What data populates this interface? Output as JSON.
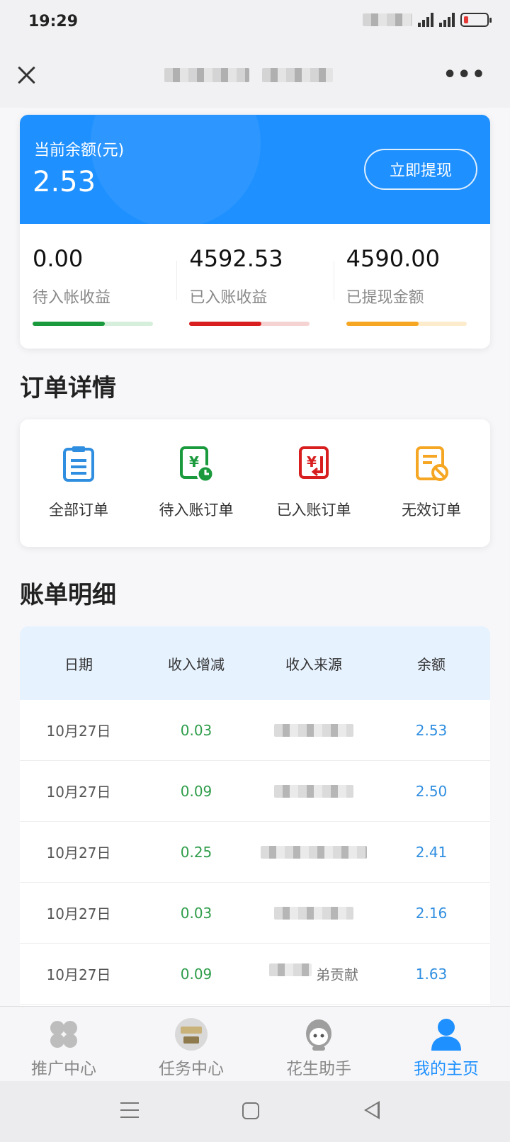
{
  "status": {
    "time": "19:29"
  },
  "header": {
    "title_obscured": true
  },
  "balance": {
    "label": "当前余额(元)",
    "value": "2.53",
    "withdraw_label": "立即提现"
  },
  "stats": [
    {
      "value": "0.00",
      "label": "待入帐收益",
      "color": "#1a9a3c",
      "track": "#d6efdc",
      "progress": 0.6
    },
    {
      "value": "4592.53",
      "label": "已入账收益",
      "color": "#d81e1e",
      "track": "#f6d3d3",
      "progress": 0.6
    },
    {
      "value": "4590.00",
      "label": "已提现金额",
      "color": "#f5a623",
      "track": "#fdeccb",
      "progress": 0.6
    }
  ],
  "orders": {
    "title": "订单详情",
    "items": [
      {
        "label": "全部订单",
        "icon": "clipboard-icon",
        "color": "#2f8ee0"
      },
      {
        "label": "待入账订单",
        "icon": "yen-clock-icon",
        "color": "#1a9a3c"
      },
      {
        "label": "已入账订单",
        "icon": "yen-return-icon",
        "color": "#d81e1e"
      },
      {
        "label": "无效订单",
        "icon": "invalid-doc-icon",
        "color": "#f5a623"
      }
    ]
  },
  "bills": {
    "title": "账单明细",
    "columns": [
      "日期",
      "收入增减",
      "收入来源",
      "余额"
    ],
    "rows": [
      {
        "date": "10月27日",
        "change": "0.03",
        "source": "",
        "balance": "2.53"
      },
      {
        "date": "10月27日",
        "change": "0.09",
        "source": "",
        "balance": "2.50"
      },
      {
        "date": "10月27日",
        "change": "0.25",
        "source": "",
        "balance": "2.41"
      },
      {
        "date": "10月27日",
        "change": "0.03",
        "source": "",
        "balance": "2.16"
      },
      {
        "date": "10月27日",
        "change": "0.09",
        "source": "弟贡献",
        "balance": "1.63"
      }
    ]
  },
  "tabs": [
    {
      "label": "推广中心",
      "icon": "clover-icon",
      "active": false
    },
    {
      "label": "任务中心",
      "icon": "task-badge-icon",
      "active": false
    },
    {
      "label": "花生助手",
      "icon": "assistant-avatar-icon",
      "active": false
    },
    {
      "label": "我的主页",
      "icon": "person-icon",
      "active": true
    }
  ],
  "accent": "#1e90ff"
}
